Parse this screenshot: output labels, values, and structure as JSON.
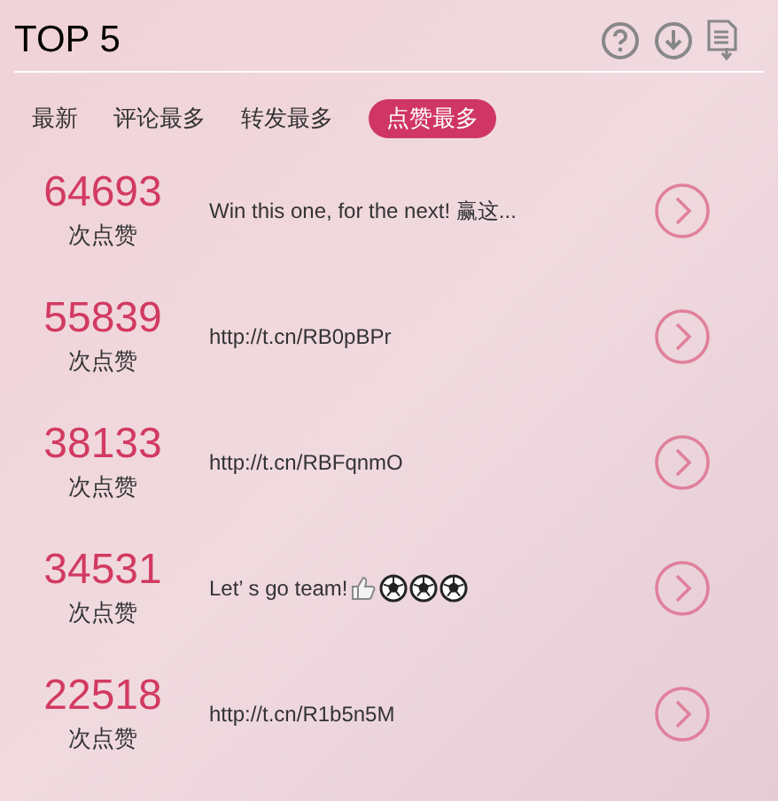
{
  "header": {
    "title": "TOP 5"
  },
  "tabs": [
    {
      "label": "最新",
      "selected": false
    },
    {
      "label": "评论最多",
      "selected": false
    },
    {
      "label": "转发最多",
      "selected": false
    },
    {
      "label": "点赞最多",
      "selected": true
    }
  ],
  "rows": [
    {
      "count": "64693",
      "unit": "次点赞",
      "text": "Win this one, for the next! 赢这..."
    },
    {
      "count": "55839",
      "unit": "次点赞",
      "text": "http://t.cn/RB0pBPr"
    },
    {
      "count": "38133",
      "unit": "次点赞",
      "text": "http://t.cn/RBFqnmO"
    },
    {
      "count": "34531",
      "unit": "次点赞",
      "text": "Let’ s go team!",
      "icons": [
        {
          "kind": "thumb"
        },
        {
          "kind": "ball"
        },
        {
          "kind": "ball"
        },
        {
          "kind": "ball"
        }
      ]
    },
    {
      "count": "22518",
      "unit": "次点赞",
      "text": "http://t.cn/R1b5n5M"
    }
  ]
}
